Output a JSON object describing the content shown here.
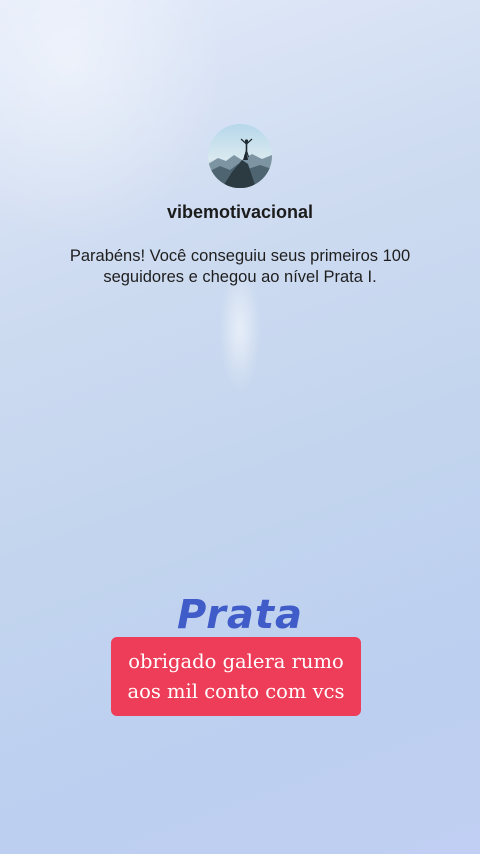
{
  "profile": {
    "username": "vibemotivacional",
    "avatar_icon": "person-on-mountain-peak-avatar"
  },
  "message": "Parabéns! Você conseguiu seus primeiros 100 seguidores e chegou ao nível Prata I.",
  "level": {
    "name": "Prata"
  },
  "caption": {
    "line1": "obrigado galera rumo",
    "line2": "aos mil conto com vcs",
    "background": "#ee3d58"
  },
  "colors": {
    "level_text": "#3f5cc8",
    "background_top": "#e4ebfa",
    "background_bottom": "#c0cff3"
  }
}
